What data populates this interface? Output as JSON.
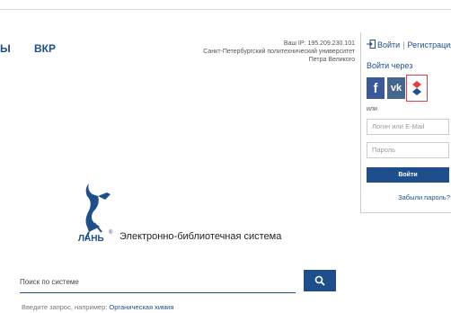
{
  "nav": {
    "item_partial": "Ы",
    "item_vkr": "ВКР"
  },
  "ip_info": {
    "ip_line": "Ваш IP: 195.209.230.101",
    "org_line1": "Санкт-Петербургский политехнический университет",
    "org_line2": "Петра Великого"
  },
  "auth": {
    "login_link": "Войти",
    "register_link": "Регистрация",
    "via_label": "Войти через",
    "or_label": "или",
    "login_placeholder": "Логин или E-Mail",
    "password_placeholder": "Пароль",
    "submit_label": "Войти",
    "forgot_link": "Забыли пароль?",
    "social": {
      "fb": "f",
      "vk": "vk",
      "lan": "lan-icon"
    }
  },
  "brand": {
    "logo_text": "ЛАНЬ",
    "system_title": "Электронно-библиотечная система"
  },
  "search": {
    "placeholder": "Поиск по системе",
    "hint_prefix": "Введите запрос, например: ",
    "hint_example": "Органическая химия"
  },
  "colors": {
    "brand_blue": "#1f4e8c",
    "lan_red": "#e24040"
  }
}
